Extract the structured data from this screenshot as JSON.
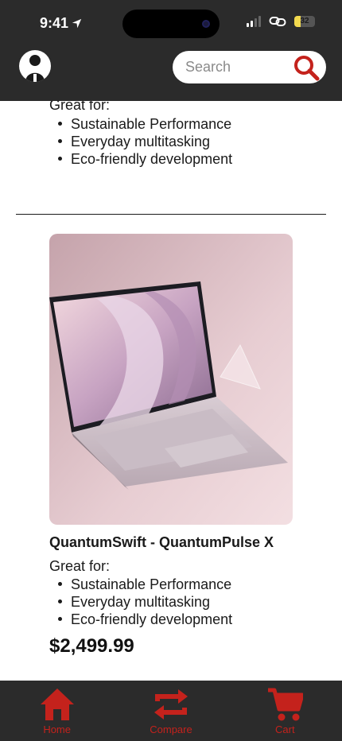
{
  "status_bar": {
    "time": "9:41",
    "battery": "32",
    "battery_level": 0.32
  },
  "header": {
    "search_placeholder": "Search"
  },
  "previous_product": {
    "great_for_label": "Great for:",
    "features": [
      "Sustainable Performance",
      "Everyday multitasking",
      "Eco-friendly development"
    ]
  },
  "product": {
    "name": "QuantumSwift - QuantumPulse X",
    "great_for_label": "Great for:",
    "features": [
      "Sustainable Performance",
      "Everyday multitasking",
      "Eco-friendly development"
    ],
    "price": "$2,499.99",
    "image_icon": "laptop-image"
  },
  "nav": {
    "items": [
      {
        "label": "Home",
        "icon": "home-icon"
      },
      {
        "label": "Compare",
        "icon": "compare-icon"
      },
      {
        "label": "Cart",
        "icon": "cart-icon"
      }
    ]
  },
  "colors": {
    "header_bg": "#2b2b2b",
    "accent": "#c4221c",
    "text": "#1a1a1a"
  }
}
